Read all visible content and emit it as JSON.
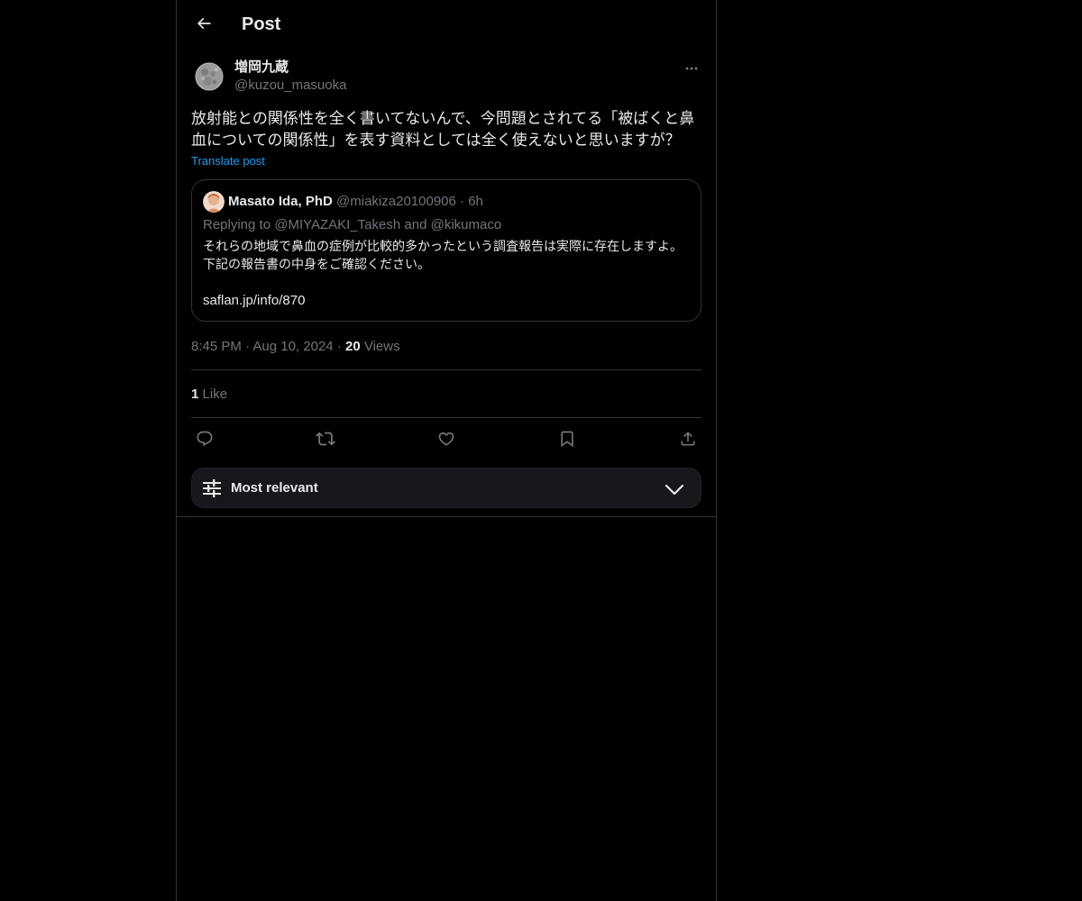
{
  "header": {
    "title": "Post"
  },
  "post": {
    "author": {
      "name": "増岡九蔵",
      "handle": "@kuzou_masuoka"
    },
    "text": "放射能との関係性を全く書いてないんで、今問題とされてる「被ばくと鼻血についての関係性」を表す資料としては全く使えないと思いますが？",
    "translate_label": "Translate post",
    "quote": {
      "name": "Masato Ida, PhD",
      "handle": "@miakiza20100906",
      "separator": "·",
      "time": "6h",
      "replying_prefix": "Replying to",
      "replying_to_1": "@MIYAZAKI_Takesh",
      "replying_and": "and",
      "replying_to_2": "@kikumaco",
      "text": "それらの地域で鼻血の症例が比較的多かったという調査報告は実際に存在しますよ。下記の報告書の中身をご確認ください。",
      "link": "saflan.jp/info/870"
    },
    "meta": {
      "time": "8:45 PM",
      "dot": "·",
      "date": "Aug 10, 2024",
      "views_count": "20",
      "views_label": "Views"
    },
    "likes": {
      "count": "1",
      "label": "Like"
    }
  },
  "actions": {
    "reply": "reply-icon",
    "repost": "repost-icon",
    "like": "heart-icon",
    "bookmark": "bookmark-icon",
    "share": "share-icon"
  },
  "sort": {
    "label": "Most relevant"
  },
  "colors": {
    "background": "#000000",
    "text": "#e7e9ea",
    "muted": "#71767b",
    "accent": "#1d9bf0",
    "border": "#2f3336",
    "sort_bg": "#16181c"
  }
}
